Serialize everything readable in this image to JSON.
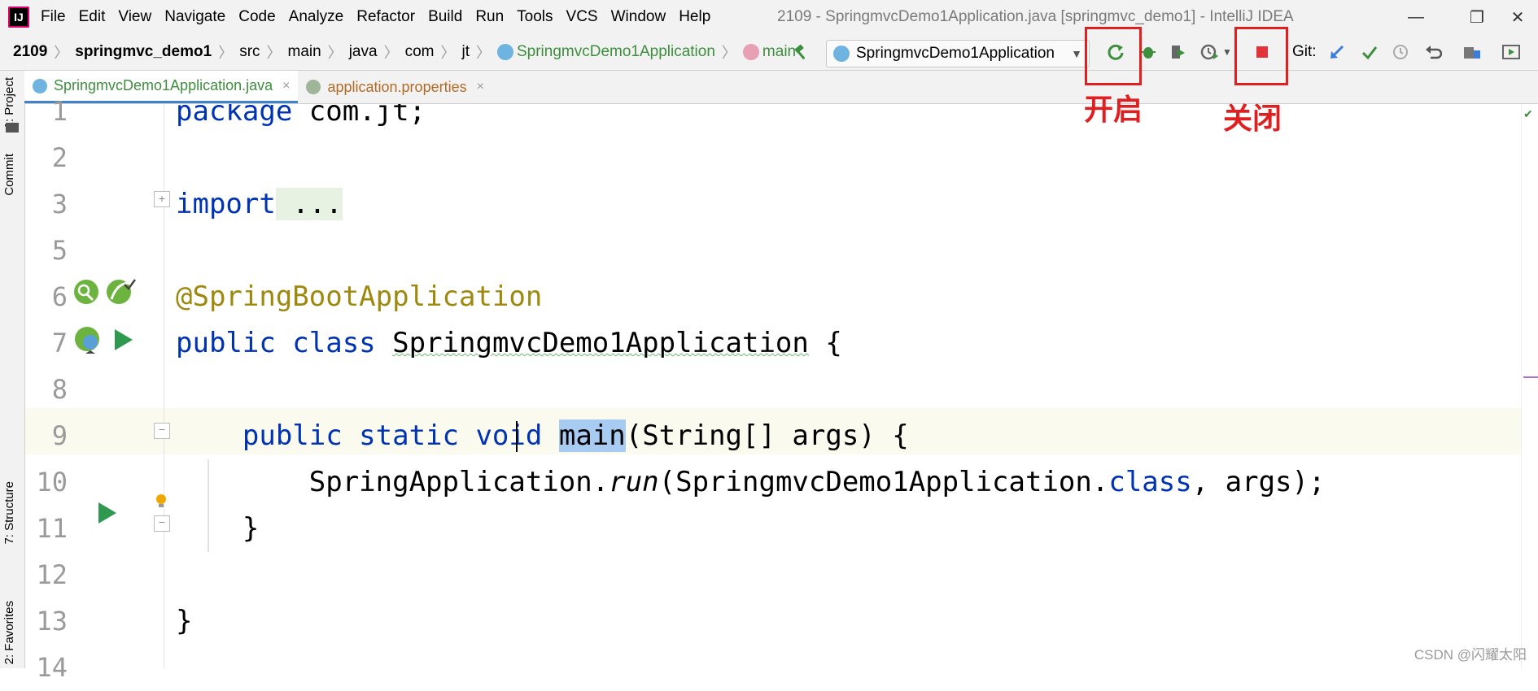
{
  "menubar": {
    "logo": "IJ",
    "items": [
      "File",
      "Edit",
      "View",
      "Navigate",
      "Code",
      "Analyze",
      "Refactor",
      "Build",
      "Run",
      "Tools",
      "VCS",
      "Window",
      "Help"
    ],
    "window_title": "2109 - SpringmvcDemo1Application.java [springmvc_demo1] - IntelliJ IDEA",
    "minimize": "—",
    "restore": "❐",
    "close": "✕"
  },
  "breadcrumb": {
    "items": [
      "2109",
      "springmvc_demo1",
      "src",
      "main",
      "java",
      "com",
      "jt",
      "SpringmvcDemo1Application",
      "main"
    ],
    "separator": "〉"
  },
  "toolbar": {
    "run_config": "SpringmvcDemo1Application",
    "git_label": "Git:",
    "accent_green": "#3d8f3d",
    "stop_color": "#e0333c"
  },
  "tabs": [
    {
      "label": "SpringmvcDemo1Application.java",
      "close": "×"
    },
    {
      "label": "application.properties",
      "close": "×"
    }
  ],
  "side_tabs": {
    "project": "1: Project",
    "commit": "Commit",
    "structure": "7: Structure",
    "favorites": "2: Favorites"
  },
  "editor": {
    "line_numbers": [
      "1",
      "2",
      "3",
      "5",
      "6",
      "7",
      "8",
      "9",
      "10",
      "11",
      "12",
      "13",
      "14"
    ],
    "code": {
      "l1_kw": "package",
      "l1_rest": " com.jt;",
      "l3_kw": "import",
      "l3_fold": " ...",
      "l6_ann": "@SpringBootApplication",
      "l7_kw": "public class",
      "l7_name": "SpringmvcDemo1Application",
      "l7_rest": " {",
      "l9_indent": "    ",
      "l9_kw": "public static void",
      "l9_space": " ",
      "l9_name": "main",
      "l9_rest": "(String[] args) {",
      "l10_indent": "        ",
      "l10_a": "SpringApplication.",
      "l10_run": "run",
      "l10_b": "(SpringmvcDemo1Application.",
      "l10_class": "class",
      "l10_c": ", args);",
      "l11": "    }",
      "l13": "}"
    }
  },
  "annotations": {
    "start": "开启",
    "stop": "关闭",
    "color": "#e02020"
  },
  "watermark": "CSDN @闪耀太阳"
}
